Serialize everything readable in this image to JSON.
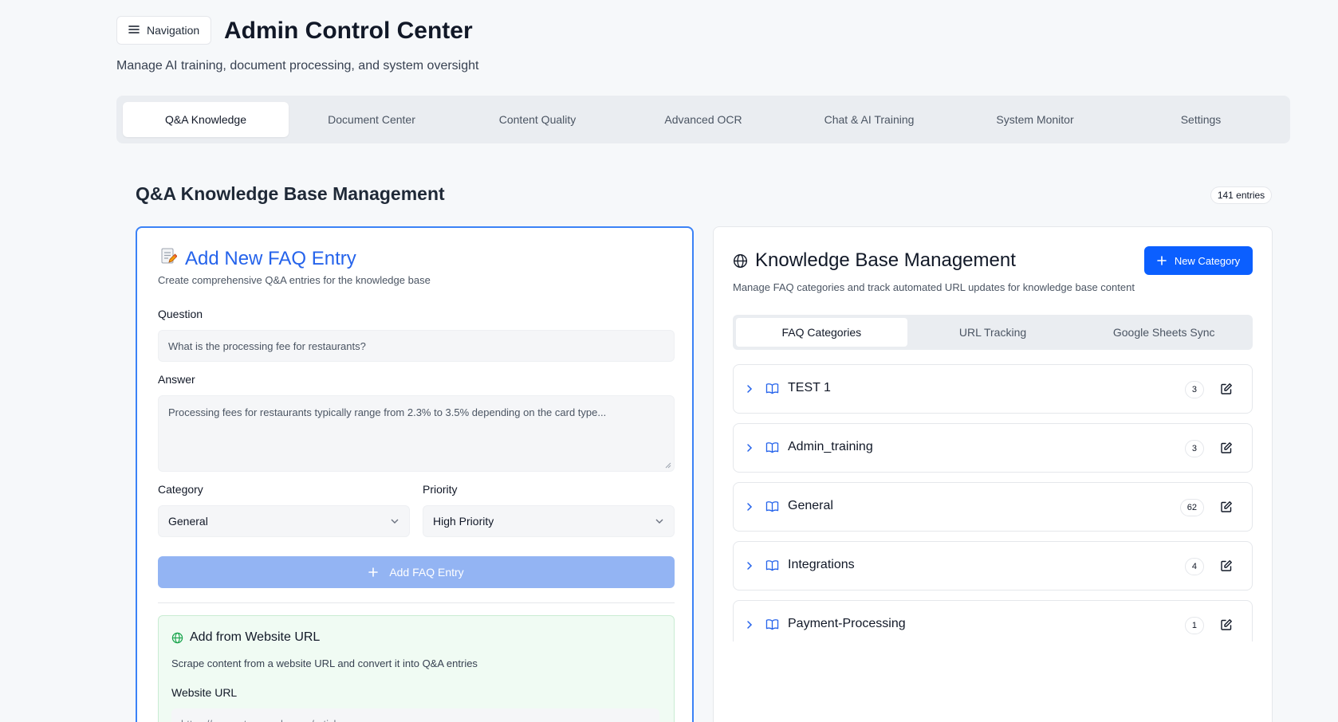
{
  "header": {
    "nav_label": "Navigation",
    "title": "Admin Control Center",
    "subtitle": "Manage AI training, document processing, and system oversight"
  },
  "main_tabs": [
    {
      "label": "Q&A Knowledge",
      "active": true
    },
    {
      "label": "Document Center"
    },
    {
      "label": "Content Quality"
    },
    {
      "label": "Advanced OCR"
    },
    {
      "label": "Chat & AI Training"
    },
    {
      "label": "System Monitor"
    },
    {
      "label": "Settings"
    }
  ],
  "section": {
    "title": "Q&A Knowledge Base Management",
    "entries_badge": "141 entries"
  },
  "faq_form": {
    "title": "Add New FAQ Entry",
    "title_icon": "memo-emoji",
    "subtitle": "Create comprehensive Q&A entries for the knowledge base",
    "question_label": "Question",
    "question_placeholder": "What is the processing fee for restaurants?",
    "answer_label": "Answer",
    "answer_placeholder": "Processing fees for restaurants typically range from 2.3% to 3.5% depending on the card type...",
    "category_label": "Category",
    "category_value": "General",
    "priority_label": "Priority",
    "priority_value": "High Priority",
    "add_button": "Add FAQ Entry"
  },
  "url_import": {
    "title": "Add from Website URL",
    "description": "Scrape content from a website URL and convert it into Q&A entries",
    "url_label": "Website URL",
    "url_placeholder": "https://support.example.com/article"
  },
  "kb_panel": {
    "title": "Knowledge Base Management",
    "subtitle": "Manage FAQ categories and track automated URL updates for knowledge base content",
    "new_category_button": "New Category",
    "tabs": [
      {
        "label": "FAQ Categories",
        "active": true
      },
      {
        "label": "URL Tracking"
      },
      {
        "label": "Google Sheets Sync"
      }
    ],
    "categories": [
      {
        "name": "TEST 1",
        "count": "3"
      },
      {
        "name": "Admin_training",
        "count": "3"
      },
      {
        "name": "General",
        "count": "62"
      },
      {
        "name": "Integrations",
        "count": "4"
      },
      {
        "name": "Payment-Processing",
        "count": "1"
      }
    ]
  },
  "colors": {
    "primary": "#0b5fff",
    "accent_blue": "#2563eb",
    "disabled_button": "#93b4f3",
    "url_box_bg": "#f0fbf3",
    "page_bg": "#f6f8fa"
  }
}
